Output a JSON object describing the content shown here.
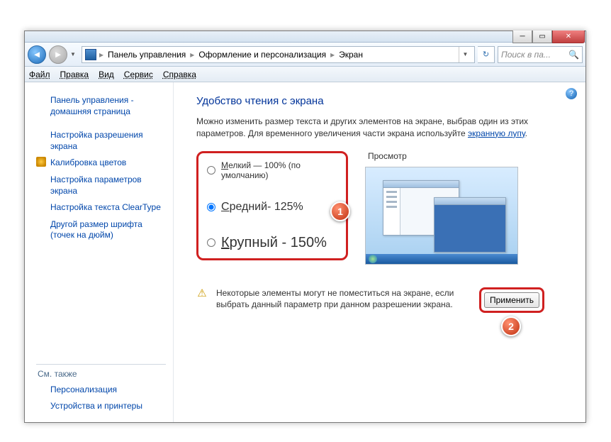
{
  "breadcrumb": {
    "seg1": "Панель управления",
    "seg2": "Оформление и персонализация",
    "seg3": "Экран"
  },
  "search": {
    "placeholder": "Поиск в па..."
  },
  "menu": {
    "file": "Файл",
    "edit": "Правка",
    "view": "Вид",
    "tools": "Сервис",
    "help": "Справка"
  },
  "sidebar": {
    "home": "Панель управления - домашняя страница",
    "resolution": "Настройка разрешения экрана",
    "calibrate": "Калибровка цветов",
    "params": "Настройка параметров экрана",
    "cleartype": "Настройка текста ClearType",
    "dpi": "Другой размер шрифта (точек на дюйм)",
    "seealso": "См. также",
    "personalize": "Персонализация",
    "devices": "Устройства и принтеры"
  },
  "main": {
    "title": "Удобство чтения с экрана",
    "desc1": "Можно изменить размер текста и других элементов на экране, выбрав один из этих параметров. Для временного увеличения части экрана используйте ",
    "magnifier_link": "экранную лупу",
    "desc_end": ".",
    "options": {
      "small": "Мелкий — 100% (по умолчанию)",
      "medium": "Средний- 125%",
      "large": "Крупный - 150%"
    },
    "preview_label": "Просмотр",
    "warning": "Некоторые элементы могут не поместиться на экране, если выбрать данный параметр при данном разрешении экрана.",
    "apply": "Применить"
  },
  "callouts": {
    "one": "1",
    "two": "2"
  }
}
